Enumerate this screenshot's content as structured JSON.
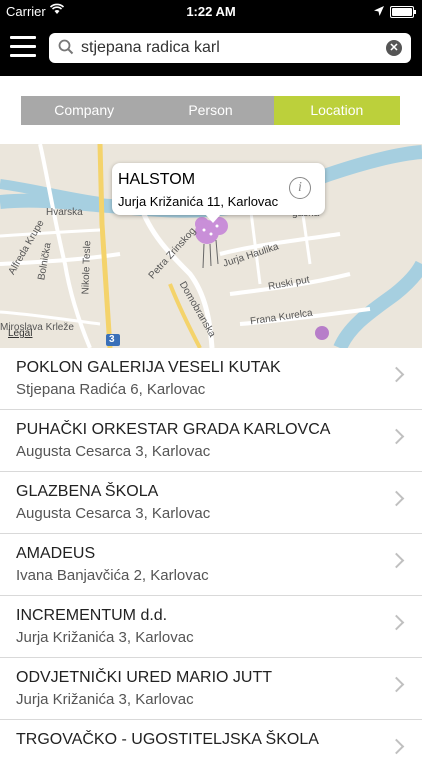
{
  "status": {
    "carrier": "Carrier",
    "time": "1:22 AM"
  },
  "search": {
    "query": "stjepana radica karl"
  },
  "segments": [
    {
      "label": "Company",
      "active": false
    },
    {
      "label": "Person",
      "active": false
    },
    {
      "label": "Location",
      "active": true
    }
  ],
  "map": {
    "labels": {
      "hvarska": "Hvarska",
      "alfreda_krupe": "Alfreda Krupe",
      "bolnicka": "Bolnička",
      "nikole_tesle": "Nikole Tesle",
      "petra_zrinskog": "Petra Zrinskog",
      "domobranska": "Domobranska",
      "jurja_haulika": "Jurja Haulika",
      "ruski_put": "Ruski put",
      "frana_kurelca": "Frana Kurelca",
      "mirosla_krleze": "Miroslava Krleže",
      "gasna": "gasna",
      "legal": "Legal",
      "route_shield": "3"
    },
    "callout": {
      "title": "HALSTOM",
      "address": "Jurja Križanića 11, Karlovac"
    }
  },
  "results": [
    {
      "name": "POKLON GALERIJA VESELI KUTAK",
      "address": "Stjepana Radića 6, Karlovac"
    },
    {
      "name": "PUHAČKI ORKESTAR GRADA KARLOVCA",
      "address": "Augusta Cesarca 3, Karlovac"
    },
    {
      "name": "GLAZBENA ŠKOLA",
      "address": "Augusta Cesarca 3, Karlovac"
    },
    {
      "name": "AMADEUS",
      "address": "Ivana Banjavčića 2, Karlovac"
    },
    {
      "name": "INCREMENTUM d.d.",
      "address": "Jurja Križanića 3, Karlovac"
    },
    {
      "name": "ODVJETNIČKI URED MARIO JUTT",
      "address": "Jurja Križanića 3, Karlovac"
    },
    {
      "name": "TRGOVAČKO - UGOSTITELJSKA ŠKOLA",
      "address": ""
    }
  ],
  "colors": {
    "accent": "#bcd03b",
    "segment_inactive": "#a8a8a8",
    "river": "#a6cfe0",
    "pin": "#c98fd8"
  }
}
